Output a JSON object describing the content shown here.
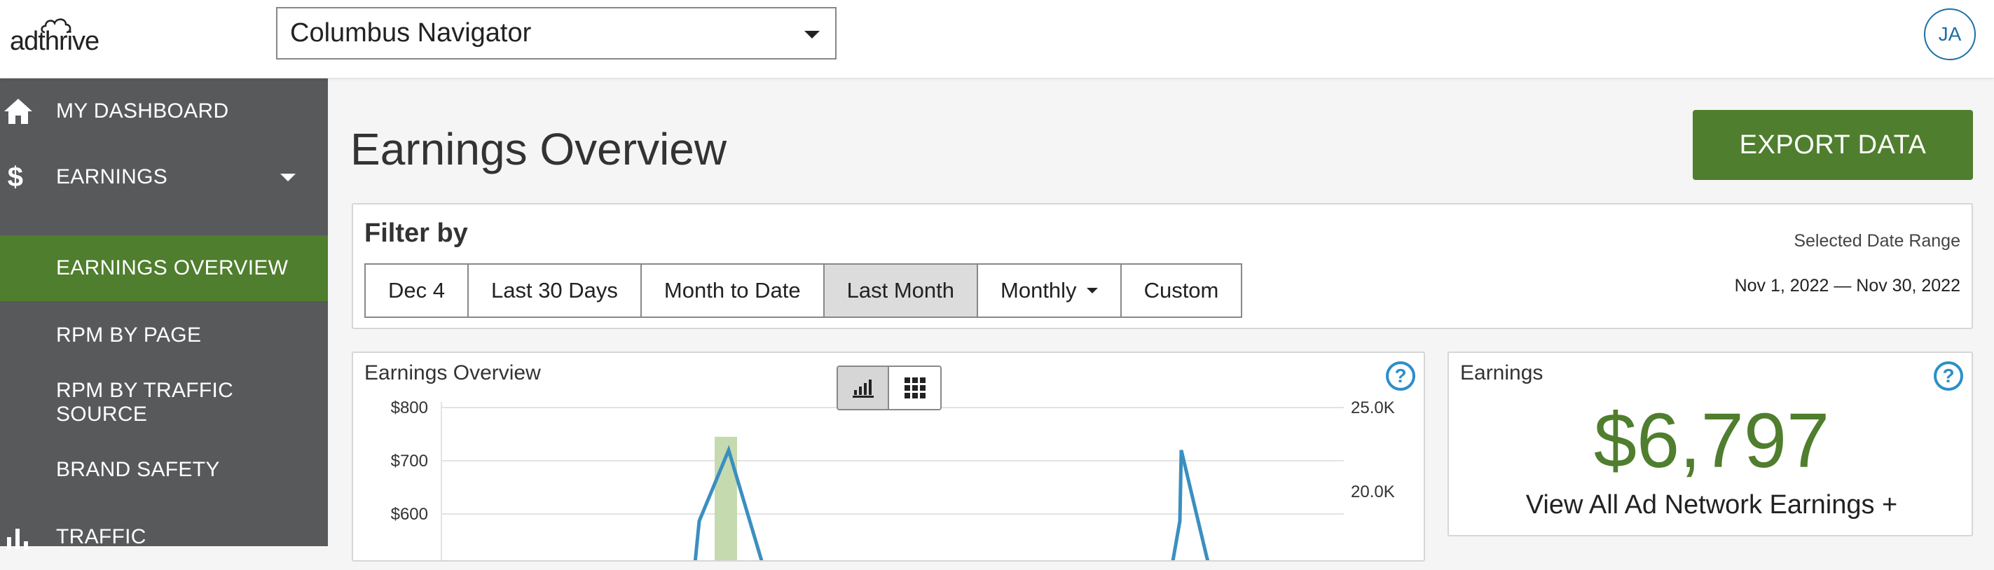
{
  "header": {
    "logo_text": "adthrive",
    "site_selector": {
      "selected": "Columbus Navigator"
    },
    "user_initials": "JA"
  },
  "sidebar": {
    "items": [
      {
        "label": "MY DASHBOARD",
        "icon": "home-icon"
      },
      {
        "label": "EARNINGS",
        "icon": "dollar-icon",
        "expanded": true
      },
      {
        "label": "EARNINGS OVERVIEW",
        "active": true
      },
      {
        "label": "RPM BY PAGE"
      },
      {
        "label": "RPM BY TRAFFIC SOURCE"
      },
      {
        "label": "BRAND SAFETY"
      },
      {
        "label": "TRAFFIC",
        "icon": "bar-chart-icon"
      }
    ]
  },
  "main": {
    "title": "Earnings Overview",
    "export_label": "EXPORT DATA",
    "filter": {
      "title": "Filter by",
      "buttons": [
        "Dec 4",
        "Last 30 Days",
        "Month to Date",
        "Last Month",
        "Monthly",
        "Custom"
      ],
      "selected": "Last Month",
      "range_label": "Selected Date Range",
      "range_value": "Nov 1, 2022 — Nov 30, 2022"
    },
    "chart_panel": {
      "title": "Earnings Overview",
      "help": "?"
    },
    "summary": {
      "title": "Earnings",
      "value": "$6,797",
      "link": "View All Ad Network Earnings +",
      "help": "?"
    }
  },
  "colors": {
    "accent_green": "#4f7e2e",
    "sidebar_bg": "#58595b",
    "help_blue": "#2c8fc9",
    "line_blue": "#3a8fc0",
    "bar_green": "#c5dbaf"
  },
  "chart_data": {
    "type": "line",
    "left_axis": {
      "ticks": [
        "$800",
        "$700",
        "$600"
      ],
      "ylim_visible": [
        550,
        800
      ]
    },
    "right_axis": {
      "ticks": [
        "25.0K",
        "20.0K"
      ]
    },
    "series": [
      {
        "values": [
          580,
          720,
          580,
          720,
          580
        ]
      }
    ],
    "bars": [
      {
        "value": 745
      }
    ]
  }
}
